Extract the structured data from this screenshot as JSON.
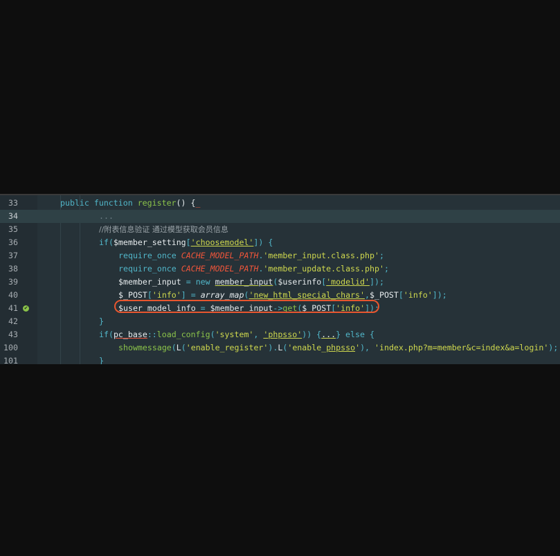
{
  "editor": {
    "highlighted_line": "34",
    "callout_line": "41",
    "gutter_marker_line": "41",
    "lines": [
      {
        "num": "33",
        "segments": [
          {
            "cls": "kw",
            "text": "public function "
          },
          {
            "cls": "fn",
            "text": "register"
          },
          {
            "cls": "var",
            "text": "() {"
          },
          {
            "cls": "const",
            "text": "_"
          }
        ]
      },
      {
        "num": "34",
        "segments": [
          {
            "cls": "dim",
            "text": "..."
          }
        ]
      },
      {
        "num": "35",
        "segments": [
          {
            "cls": "cmt",
            "text": "//附表信息验证 通过模型获取会员信息"
          }
        ]
      },
      {
        "num": "36",
        "segments": [
          {
            "cls": "kw",
            "text": "if("
          },
          {
            "cls": "var",
            "text": "$member_setting"
          },
          {
            "cls": "kw",
            "text": "["
          },
          {
            "cls": "str ul",
            "text": "'choosemodel'"
          },
          {
            "cls": "kw",
            "text": "]) {"
          }
        ]
      },
      {
        "num": "37",
        "segments": [
          {
            "cls": "kw",
            "text": "require_once "
          },
          {
            "cls": "const",
            "text": "CACHE_MODEL_PATH"
          },
          {
            "cls": "kw",
            "text": "."
          },
          {
            "cls": "str",
            "text": "'member_input.class.php'"
          },
          {
            "cls": "kw",
            "text": ";"
          }
        ]
      },
      {
        "num": "38",
        "segments": [
          {
            "cls": "kw",
            "text": "require_once "
          },
          {
            "cls": "const",
            "text": "CACHE_MODEL_PATH"
          },
          {
            "cls": "kw",
            "text": "."
          },
          {
            "cls": "str",
            "text": "'member_update.class.php'"
          },
          {
            "cls": "kw",
            "text": ";"
          }
        ]
      },
      {
        "num": "39",
        "segments": [
          {
            "cls": "var",
            "text": "$member_input "
          },
          {
            "cls": "kw",
            "text": "= new "
          },
          {
            "cls": "var ul",
            "text": "member_input"
          },
          {
            "cls": "kw",
            "text": "("
          },
          {
            "cls": "var",
            "text": "$userinfo"
          },
          {
            "cls": "kw",
            "text": "["
          },
          {
            "cls": "str ul",
            "text": "'modelid'"
          },
          {
            "cls": "kw",
            "text": "]);"
          }
        ]
      },
      {
        "num": "40",
        "segments": [
          {
            "cls": "var",
            "text": "$_POST"
          },
          {
            "cls": "kw",
            "text": "["
          },
          {
            "cls": "str",
            "text": "'info'"
          },
          {
            "cls": "kw",
            "text": "] = "
          },
          {
            "cls": "ital",
            "text": "array_map"
          },
          {
            "cls": "kw",
            "text": "("
          },
          {
            "cls": "str ul",
            "text": "'new_html_special_chars'"
          },
          {
            "cls": "kw",
            "text": ","
          },
          {
            "cls": "var",
            "text": "$_POST"
          },
          {
            "cls": "kw",
            "text": "["
          },
          {
            "cls": "str",
            "text": "'info'"
          },
          {
            "cls": "kw",
            "text": "]);"
          }
        ]
      },
      {
        "num": "41",
        "segments": [
          {
            "cls": "var",
            "text": "$user_model_info "
          },
          {
            "cls": "kw",
            "text": "= "
          },
          {
            "cls": "var",
            "text": "$member_input"
          },
          {
            "cls": "kw",
            "text": "->"
          },
          {
            "cls": "fn",
            "text": "get"
          },
          {
            "cls": "kw",
            "text": "("
          },
          {
            "cls": "var",
            "text": "$_POST"
          },
          {
            "cls": "kw",
            "text": "["
          },
          {
            "cls": "str",
            "text": "'info'"
          },
          {
            "cls": "kw",
            "text": "]);"
          }
        ]
      },
      {
        "num": "42",
        "segments": [
          {
            "cls": "kw",
            "text": "}"
          }
        ]
      },
      {
        "num": "43",
        "segments": [
          {
            "cls": "kw",
            "text": "if("
          },
          {
            "cls": "var ul-red",
            "text": "pc_base"
          },
          {
            "cls": "kw",
            "text": "::"
          },
          {
            "cls": "fn",
            "text": "load_config"
          },
          {
            "cls": "kw",
            "text": "("
          },
          {
            "cls": "str",
            "text": "'system'"
          },
          {
            "cls": "kw",
            "text": ", "
          },
          {
            "cls": "str ul",
            "text": "'phpsso'"
          },
          {
            "cls": "kw",
            "text": ")) {"
          },
          {
            "cls": "var ul",
            "text": "..."
          },
          {
            "cls": "kw",
            "text": "} else {"
          }
        ]
      },
      {
        "num": "100",
        "segments": [
          {
            "cls": "fn",
            "text": "showmessage"
          },
          {
            "cls": "kw",
            "text": "("
          },
          {
            "cls": "var",
            "text": "L"
          },
          {
            "cls": "kw",
            "text": "("
          },
          {
            "cls": "str",
            "text": "'enable_register'"
          },
          {
            "cls": "kw",
            "text": ")."
          },
          {
            "cls": "var",
            "text": "L"
          },
          {
            "cls": "kw",
            "text": "("
          },
          {
            "cls": "str",
            "text": "'enable_"
          },
          {
            "cls": "str ul",
            "text": "phpsso"
          },
          {
            "cls": "str",
            "text": "'"
          },
          {
            "cls": "kw",
            "text": "), "
          },
          {
            "cls": "str",
            "text": "'index.php?m=member&c=index&a=login'"
          },
          {
            "cls": "kw",
            "text": ");"
          }
        ]
      },
      {
        "num": "101",
        "segments": [
          {
            "cls": "kw",
            "text": "}"
          }
        ]
      }
    ]
  }
}
